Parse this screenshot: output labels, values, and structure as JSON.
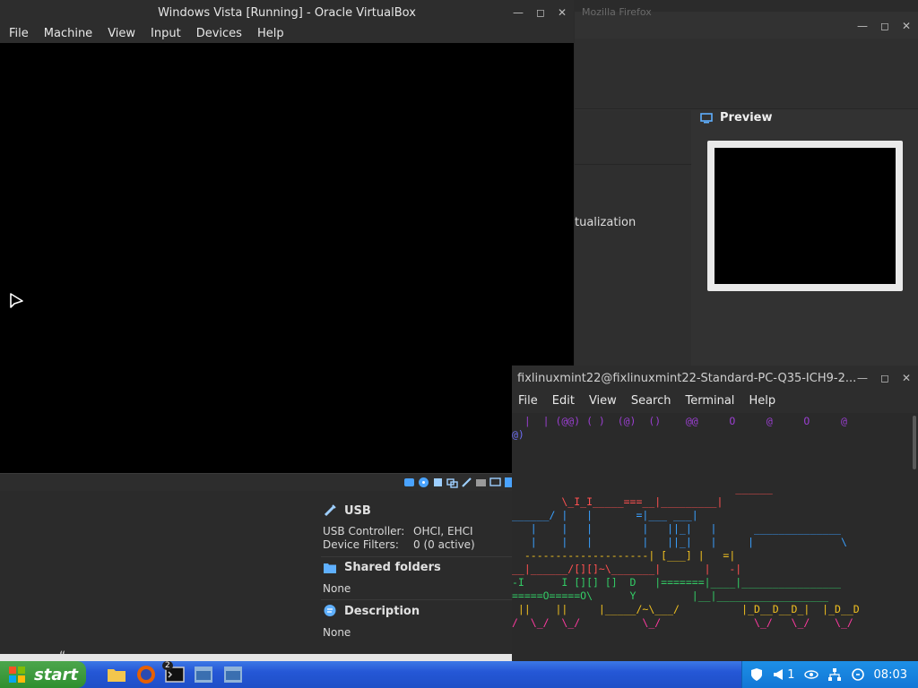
{
  "vbox": {
    "title": "Windows Vista [Running] - Oracle VirtualBox",
    "menu": [
      "File",
      "Machine",
      "View",
      "Input",
      "Devices",
      "Help"
    ],
    "status_host_key": "Ri"
  },
  "manager": {
    "bg_title": "Mozilla Firefox",
    "preview_label": "Preview",
    "virt_text": "tualization"
  },
  "details": {
    "usb_title": "USB",
    "usb_controller_label": "USB Controller:",
    "usb_controller_value": "OHCI, EHCI",
    "device_filters_label": "Device Filters:",
    "device_filters_value": "0 (0 active)",
    "shared_title": "Shared folders",
    "shared_value": "None",
    "desc_title": "Description",
    "desc_value": "None"
  },
  "terminal": {
    "title": "fixlinuxmint22@fixlinuxmint22-Standard-PC-Q35-ICH9-2...",
    "menu": [
      "File",
      "Edit",
      "View",
      "Search",
      "Terminal",
      "Help"
    ],
    "lines": [
      {
        "text": "  |  | (@@) ( )  (@)  ()    @@     O     @     O     @",
        "color": "#9a3fd0"
      },
      {
        "text": "@)",
        "color": "#6c6cf0"
      },
      {
        "text": "",
        "color": "#ffffff"
      },
      {
        "text": "",
        "color": "#ffffff"
      },
      {
        "text": "",
        "color": "#ffffff"
      },
      {
        "text": "                                    ______",
        "color": "#ff5050"
      },
      {
        "text": "        \\_I_I_____===__|_________|",
        "color": "#ff5050"
      },
      {
        "text": "______/ |   |       =|___ ___|",
        "color": "#3aa0ff"
      },
      {
        "text": "   |    |   |        |   ||_|   |      ______________",
        "color": "#3aa0ff"
      },
      {
        "text": "   |    |   |        |   ||_|   |     |              \\",
        "color": "#3aa0ff"
      },
      {
        "text": "  --------------------| [___] |   =|",
        "color": "#f0c020"
      },
      {
        "text": "__|______/[][]~\\_______|       |   -|",
        "color": "#ff5050"
      },
      {
        "text": "-I      I [][] []  D   |=======|____|________________",
        "color": "#33cc66"
      },
      {
        "text": "=====O=====O\\      Y         |__|__________________",
        "color": "#33cc66"
      },
      {
        "text": " ||    ||     |_____/~\\___/          |_D__D__D_|  |_D__D",
        "color": "#f0c020"
      },
      {
        "text": "/  \\_/  \\_/          \\_/               \\_/   \\_/    \\_/",
        "color": "#ff3aa0"
      }
    ]
  },
  "taskbar": {
    "start_label": "start",
    "clock": "08:03",
    "badge": "2",
    "tray_count": "1"
  }
}
